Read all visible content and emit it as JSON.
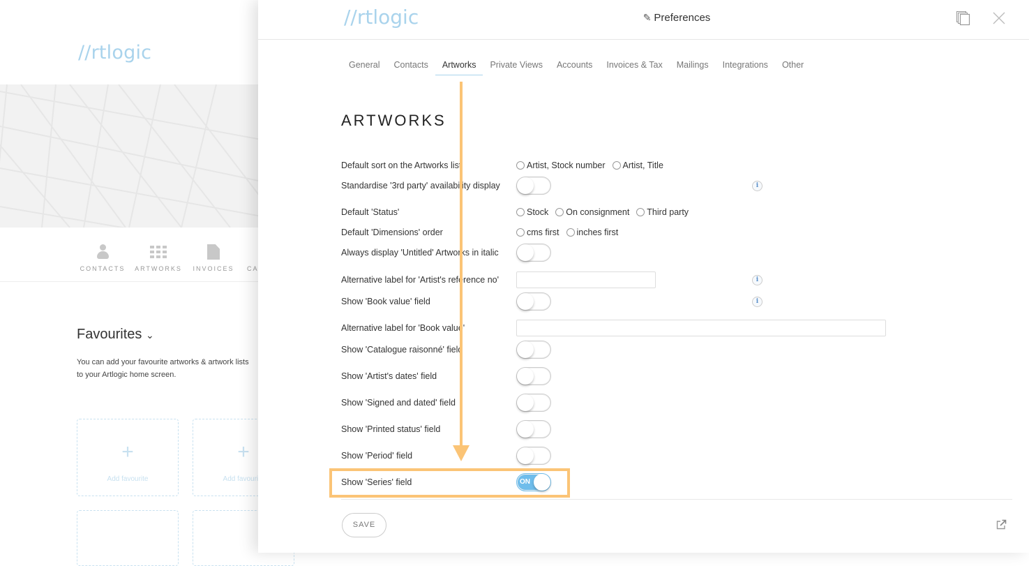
{
  "background": {
    "logo": "//rtlogic",
    "nav": [
      {
        "label": "CONTACTS",
        "icon": "person-icon"
      },
      {
        "label": "ARTWORKS",
        "icon": "grid-icon"
      },
      {
        "label": "INVOICES",
        "icon": "document-icon"
      },
      {
        "label": "CA",
        "icon": ""
      }
    ],
    "favourites": {
      "title": "Favourites",
      "chevron": "⌄",
      "text_line1": "You can add your favourite artworks & artwork lists",
      "text_line2": "to your Artlogic home screen.",
      "add_label": "Add favourite",
      "plus": "+"
    }
  },
  "drawer": {
    "logo": "//rtlogic",
    "title_icon": "✎",
    "title": "Preferences",
    "tabs": [
      {
        "label": "General",
        "active": false
      },
      {
        "label": "Contacts",
        "active": false
      },
      {
        "label": "Artworks",
        "active": true
      },
      {
        "label": "Private Views",
        "active": false
      },
      {
        "label": "Accounts",
        "active": false
      },
      {
        "label": "Invoices & Tax",
        "active": false
      },
      {
        "label": "Mailings",
        "active": false
      },
      {
        "label": "Integrations",
        "active": false
      },
      {
        "label": "Other",
        "active": false
      }
    ],
    "section_title": "ARTWORKS",
    "settings": {
      "default_sort": {
        "label": "Default sort on the Artworks list",
        "options": [
          "Artist, Stock number",
          "Artist, Title"
        ]
      },
      "standardise": {
        "label": "Standardise '3rd party' availability display",
        "value": "off"
      },
      "default_status": {
        "label": "Default 'Status'",
        "options": [
          "Stock",
          "On consignment",
          "Third party"
        ]
      },
      "dimensions": {
        "label": "Default 'Dimensions' order",
        "options": [
          "cms first",
          "inches first"
        ]
      },
      "untitled_italic": {
        "label": "Always display 'Untitled' Artworks in italic",
        "value": "off"
      },
      "alt_artist_ref": {
        "label": "Alternative label for 'Artist's reference no'",
        "value": ""
      },
      "book_value": {
        "label": "Show 'Book value' field",
        "value": "off"
      },
      "alt_book_value": {
        "label": "Alternative label for 'Book value'",
        "value": ""
      },
      "catalogue": {
        "label": "Show 'Catalogue raisonné' field",
        "value": "off"
      },
      "artist_dates": {
        "label": "Show 'Artist's dates' field",
        "value": "off"
      },
      "signed_dated": {
        "label": "Show 'Signed and dated' field",
        "value": "off"
      },
      "printed_status": {
        "label": "Show 'Printed status' field",
        "value": "off"
      },
      "period": {
        "label": "Show 'Period' field",
        "value": "off"
      },
      "series": {
        "label": "Show 'Series' field",
        "value": "on",
        "on_label": "ON"
      }
    },
    "info_glyph": "i",
    "save_label": "SAVE"
  },
  "colors": {
    "brand": "#a9d3ec",
    "toggle_on": "#6fbdeb",
    "annotation": "#fbc476"
  }
}
